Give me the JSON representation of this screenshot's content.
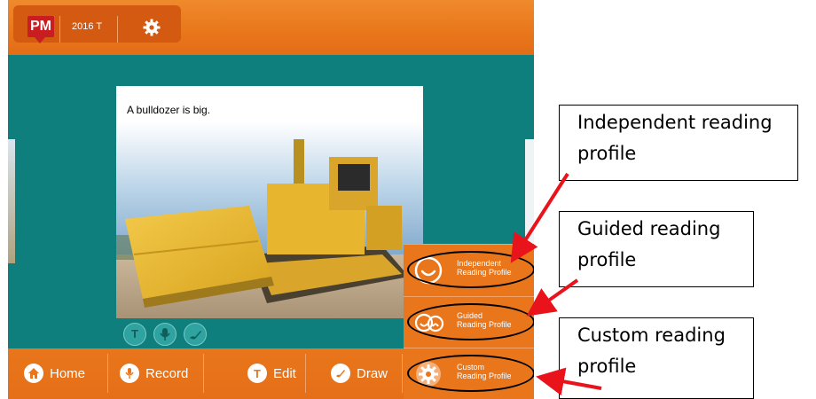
{
  "app": {
    "logo": "PM",
    "level_label": "2016 T",
    "page_caption": "A bulldozer is big.",
    "mini_tools": [
      {
        "icon": "edit-t-icon",
        "glyph": "T"
      },
      {
        "icon": "microphone-icon",
        "glyph": ""
      },
      {
        "icon": "draw-brush-icon",
        "glyph": ""
      }
    ],
    "bottom_nav": [
      {
        "label": "Home",
        "icon": "home-icon"
      },
      {
        "label": "Record",
        "icon": "microphone-icon"
      },
      {
        "label": "Edit",
        "icon": "edit-t-icon",
        "glyph": "T"
      },
      {
        "label": "Draw",
        "icon": "draw-brush-icon"
      }
    ],
    "profiles": [
      {
        "line1": "Independent",
        "line2": "Reading Profile",
        "icon": "smiley-icon"
      },
      {
        "line1": "Guided",
        "line2": "Reading Profile",
        "icon": "two-faces-icon"
      },
      {
        "line1": "Custom",
        "line2": "Reading Profile",
        "icon": "gear-icon"
      }
    ],
    "colors": {
      "accent": "#e9761b",
      "stage": "#0f7f7d",
      "logo": "#c81e22"
    }
  },
  "annotations": [
    {
      "line1": "Independent reading",
      "line2": "profile"
    },
    {
      "line1": "Guided reading",
      "line2": "profile"
    },
    {
      "line1": "Custom reading",
      "line2": "profile"
    }
  ]
}
